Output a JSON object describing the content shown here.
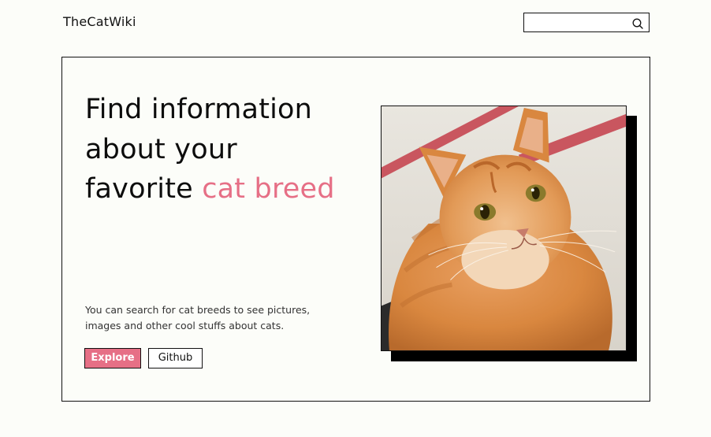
{
  "header": {
    "logo": "TheCatWiki",
    "search": {
      "value": "",
      "placeholder": "",
      "icon": "search-icon"
    }
  },
  "hero": {
    "headline_plain": "Find information about your favorite ",
    "headline_accent": "cat breed",
    "description": "You can search for cat breeds to see pictures, images and other cool stuffs about cats.",
    "explore_label": "Explore",
    "github_label": "Github",
    "image": "orange-tabby-cat-photo"
  },
  "colors": {
    "accent": "#e66f86",
    "background": "#fcfdf9",
    "border": "#111111"
  }
}
